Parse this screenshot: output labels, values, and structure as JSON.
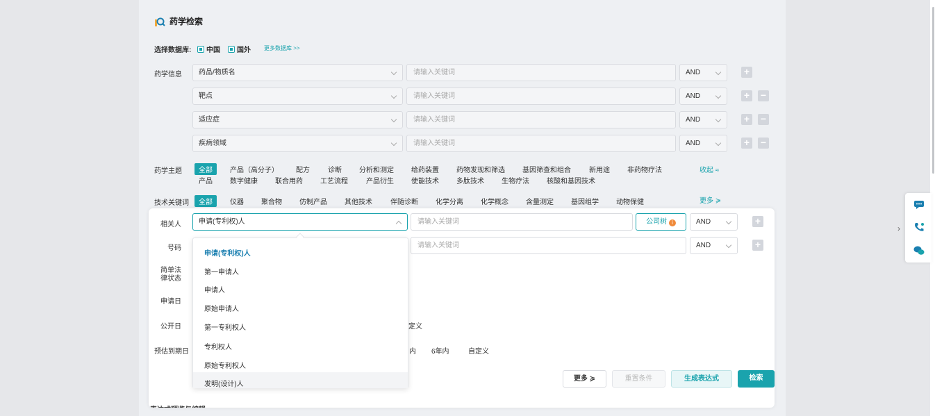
{
  "title": "药学检索",
  "database": {
    "label": "选择数据库:",
    "options": [
      "中国",
      "国外"
    ],
    "more_link": "更多数据库 >>"
  },
  "pharma_info": {
    "label": "药学信息",
    "rows": [
      {
        "field": "药品/物质名",
        "placeholder": "请输入关键词",
        "op": "AND"
      },
      {
        "field": "靶点",
        "placeholder": "请输入关键词",
        "op": "AND"
      },
      {
        "field": "适应症",
        "placeholder": "请输入关键词",
        "op": "AND"
      },
      {
        "field": "疾病领域",
        "placeholder": "请输入关键词",
        "op": "AND"
      }
    ]
  },
  "topic": {
    "label": "药学主题",
    "all": "全部",
    "row1": [
      "产品（高分子）",
      "配方",
      "诊断",
      "分析和测定",
      "给药装置",
      "药物发现和筛选",
      "基因筛查和组合",
      "新用途",
      "非药物疗法"
    ],
    "row2": [
      "产品",
      "数字健康",
      "联合用药",
      "工艺流程",
      "产品衍生",
      "使能技术",
      "多肽技术",
      "生物疗法",
      "核酸和基因技术"
    ],
    "collapse": "收起 ≈"
  },
  "tech": {
    "label": "技术关键词",
    "all": "全部",
    "items": [
      "仪器",
      "聚合物",
      "仿制产品",
      "其他技术",
      "伴随诊断",
      "化学分离",
      "化学概念",
      "含量测定",
      "基因组学",
      "动物保健"
    ],
    "more": "更多 ≽"
  },
  "form": {
    "related_label": "相关人",
    "related_field": "申请(专利权)人",
    "related_placeholder": "请输入关键词",
    "company_tree": "公司树",
    "op": "AND",
    "number_label": "号码",
    "number_placeholder": "请输入关键词",
    "number_op": "AND",
    "legal_label": "简单法律状态",
    "apply_label": "申请日",
    "publish_label": "公开日",
    "publish_tail": "定义",
    "expiry_label": "预估到期日",
    "expiry_opts": [
      "内",
      "6年内",
      "自定义"
    ],
    "expr_label": "表达式预览与编辑:"
  },
  "dropdown": {
    "items": [
      "申请(专利权)人",
      "第一申请人",
      "申请人",
      "原始申请人",
      "第一专利权人",
      "专利权人",
      "原始专利权人",
      "发明(设计)人"
    ]
  },
  "actions": {
    "more": "更多 ≽",
    "reset": "重置条件",
    "generate": "生成表达式",
    "search": "检索"
  },
  "colors": {
    "accent": "#1aa3ad"
  }
}
